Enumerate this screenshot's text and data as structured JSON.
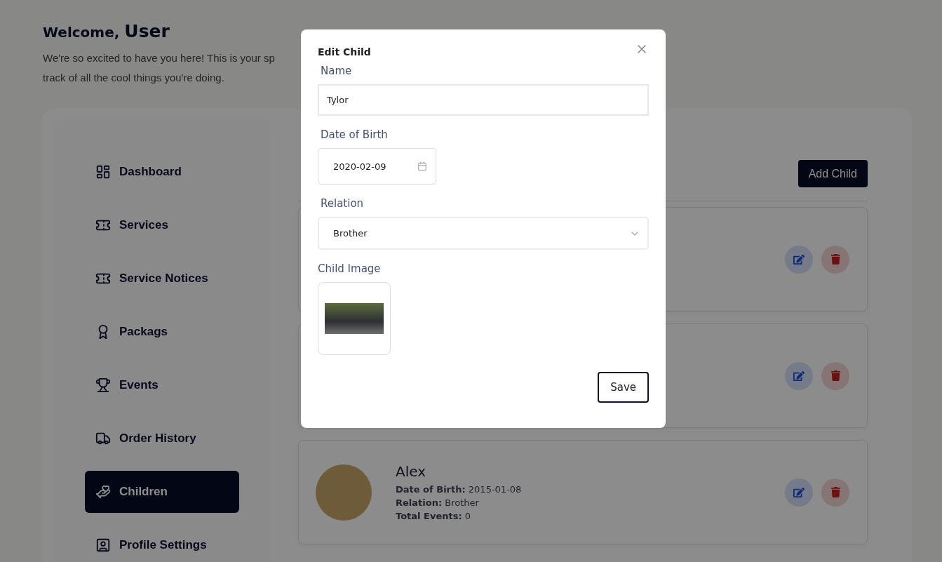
{
  "welcome": {
    "greeting": "Welcome,",
    "user": "User",
    "message": "We're so excited to have you here! This is your sp",
    "message_line2": "track of all the cool things you're doing."
  },
  "sidebar": {
    "items": [
      {
        "label": "Dashboard",
        "selected": false
      },
      {
        "label": "Services",
        "selected": false
      },
      {
        "label": "Service Notices",
        "selected": false
      },
      {
        "label": "Packags",
        "selected": false
      },
      {
        "label": "Events",
        "selected": false
      },
      {
        "label": "Order History",
        "selected": false
      },
      {
        "label": "Children",
        "selected": true
      },
      {
        "label": "Profile Settings",
        "selected": false
      }
    ]
  },
  "content": {
    "add_button": "Add Child",
    "children": [
      {
        "kind": "covered"
      },
      {
        "kind": "covered"
      },
      {
        "kind": "detail",
        "name": "Alex",
        "dob_label": "Date of Birth:",
        "dob": "2015-01-08",
        "relation_label": "Relation:",
        "relation": "Brother",
        "events_label": "Total Events:",
        "events": "0"
      }
    ]
  },
  "modal": {
    "title": "Edit Child",
    "fields": [
      {
        "kind": "text",
        "label": "Name",
        "value": "Tylor"
      },
      {
        "kind": "date",
        "label": "Date of Birth",
        "value": "2020-02-09"
      },
      {
        "kind": "select",
        "label": "Relation",
        "value": "Brother"
      },
      {
        "kind": "image",
        "label": "Child Image"
      }
    ],
    "save": "Save"
  }
}
